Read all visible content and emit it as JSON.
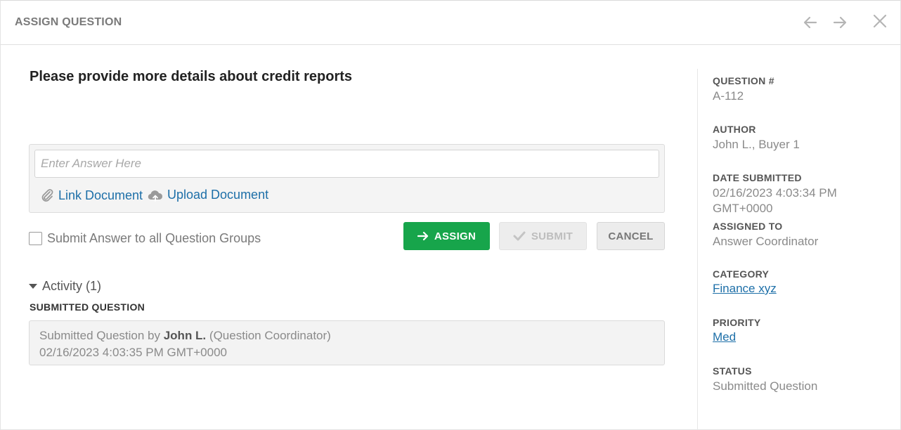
{
  "header": {
    "title": "ASSIGN QUESTION",
    "icons": {
      "back": "arrow-left-icon",
      "forward": "arrow-right-icon",
      "close": "close-icon"
    }
  },
  "question": {
    "title": "Please provide more details about credit reports"
  },
  "answer": {
    "placeholder": "Enter Answer Here",
    "value": "",
    "link_document": "Link Document",
    "upload_document": "Upload Document",
    "submit_all_label": "Submit Answer to all Question Groups"
  },
  "buttons": {
    "assign": "ASSIGN",
    "submit": "SUBMIT",
    "cancel": "CANCEL"
  },
  "activity": {
    "toggle_label": "Activity (1)",
    "section_label": "SUBMITTED QUESTION",
    "entry": {
      "prefix": "Submitted Question by",
      "author": "John L.",
      "role": "(Question Coordinator)",
      "timestamp": "02/16/2023 4:03:35 PM GMT+0000"
    }
  },
  "details": {
    "question_number_label": "QUESTION #",
    "question_number": "A-112",
    "author_label": "AUTHOR",
    "author": "John L., Buyer 1",
    "date_label": "DATE SUBMITTED",
    "date_line1": "02/16/2023 4:03:34 PM",
    "date_line2": "GMT+0000",
    "assigned_label": "ASSIGNED TO",
    "assigned": "Answer Coordinator",
    "category_label": "CATEGORY",
    "category": "Finance xyz",
    "priority_label": "PRIORITY",
    "priority": "Med",
    "status_label": "STATUS",
    "status": "Submitted Question"
  },
  "colors": {
    "accent_green": "#17a54b",
    "link_blue": "#1d6fa8"
  }
}
